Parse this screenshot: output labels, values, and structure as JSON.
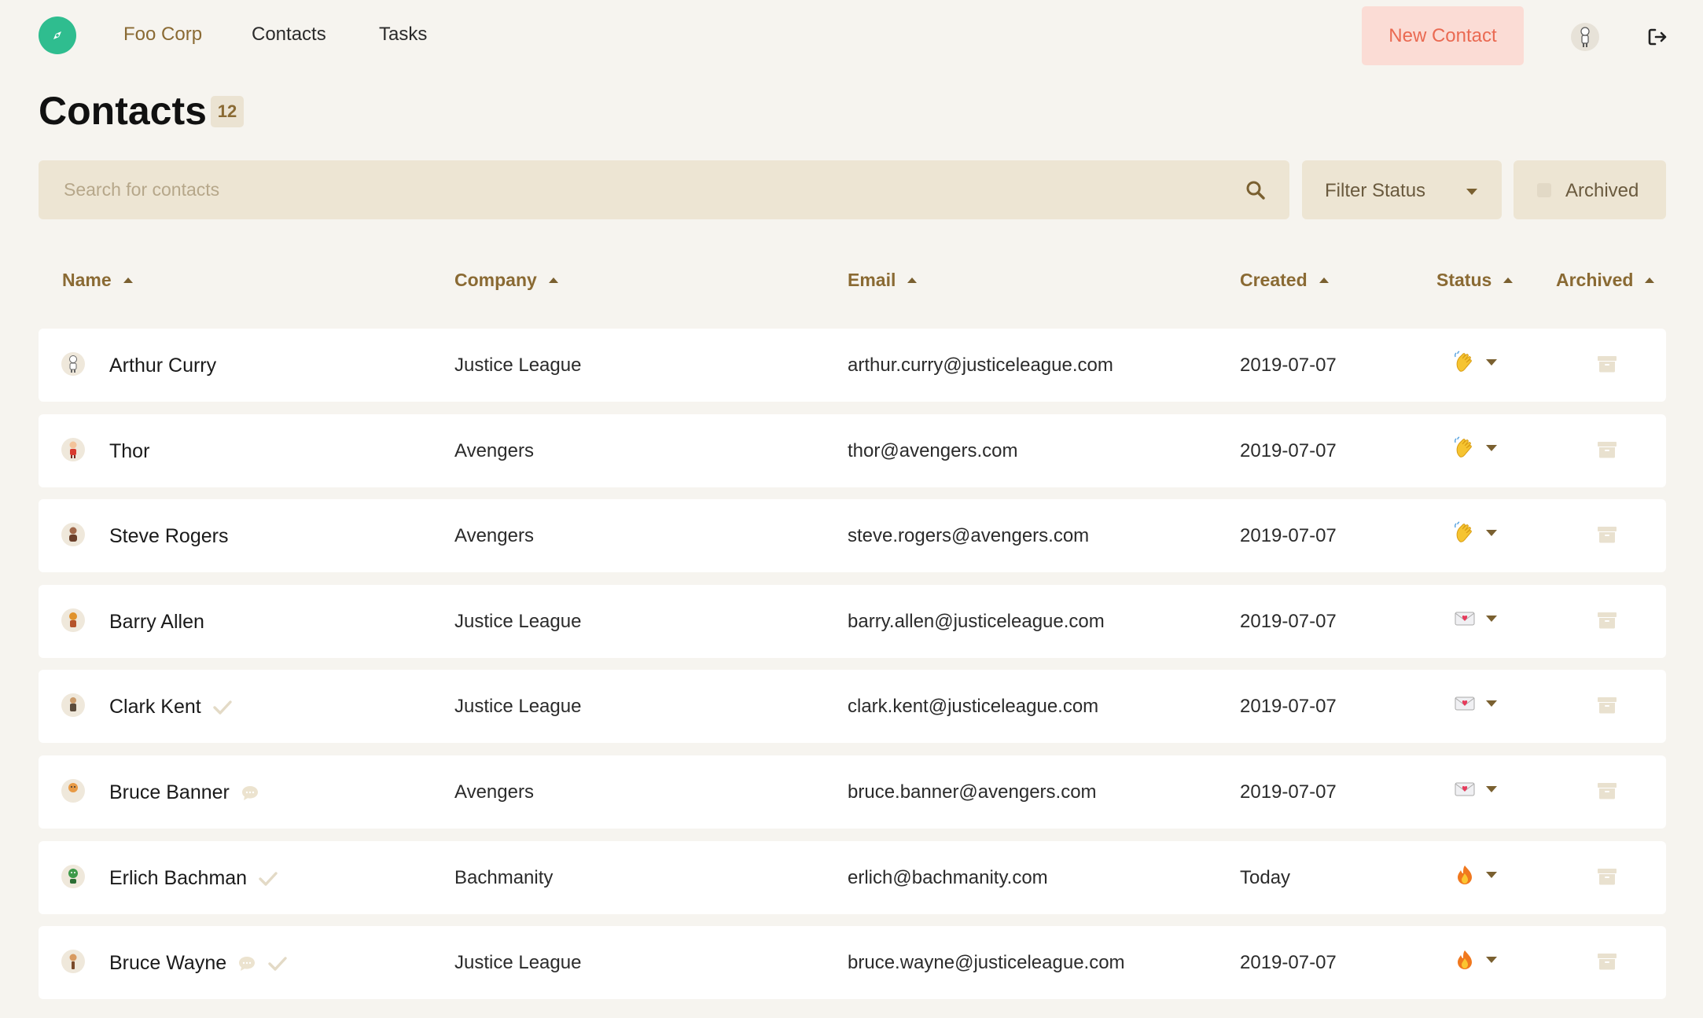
{
  "header": {
    "brand": "Foo Corp",
    "nav": [
      {
        "label": "Contacts"
      },
      {
        "label": "Tasks"
      }
    ],
    "new_contact_label": "New Contact"
  },
  "page": {
    "title": "Contacts",
    "count": "12"
  },
  "toolbar": {
    "search_placeholder": "Search for contacts",
    "search_value": "",
    "filter_label": "Filter Status",
    "archived_label": "Archived"
  },
  "table": {
    "columns": [
      "Name",
      "Company",
      "Email",
      "Created",
      "Status",
      "Archived"
    ],
    "rows": [
      {
        "name": "Arthur Curry",
        "company": "Justice League",
        "email": "arthur.curry@justiceleague.com",
        "created": "2019-07-07",
        "status": "waving-hand",
        "avatar": "arthur",
        "has_comment": false,
        "has_check": false
      },
      {
        "name": "Thor",
        "company": "Avengers",
        "email": "thor@avengers.com",
        "created": "2019-07-07",
        "status": "waving-hand",
        "avatar": "thor",
        "has_comment": false,
        "has_check": false
      },
      {
        "name": "Steve Rogers",
        "company": "Avengers",
        "email": "steve.rogers@avengers.com",
        "created": "2019-07-07",
        "status": "waving-hand",
        "avatar": "steve",
        "has_comment": false,
        "has_check": false
      },
      {
        "name": "Barry Allen",
        "company": "Justice League",
        "email": "barry.allen@justiceleague.com",
        "created": "2019-07-07",
        "status": "love-letter",
        "avatar": "barry",
        "has_comment": false,
        "has_check": false
      },
      {
        "name": "Clark Kent",
        "company": "Justice League",
        "email": "clark.kent@justiceleague.com",
        "created": "2019-07-07",
        "status": "love-letter",
        "avatar": "clark",
        "has_comment": false,
        "has_check": true
      },
      {
        "name": "Bruce Banner",
        "company": "Avengers",
        "email": "bruce.banner@avengers.com",
        "created": "2019-07-07",
        "status": "love-letter",
        "avatar": "banner",
        "has_comment": true,
        "has_check": false
      },
      {
        "name": "Erlich Bachman",
        "company": "Bachmanity",
        "email": "erlich@bachmanity.com",
        "created": "Today",
        "status": "fire",
        "avatar": "erlich",
        "has_comment": false,
        "has_check": true
      },
      {
        "name": "Bruce Wayne",
        "company": "Justice League",
        "email": "bruce.wayne@justiceleague.com",
        "created": "2019-07-07",
        "status": "fire",
        "avatar": "wayne",
        "has_comment": true,
        "has_check": true
      }
    ]
  },
  "colors": {
    "background": "#f6f4ef",
    "accent_brown": "#8a6a33",
    "brand_green": "#2fbd8f",
    "new_contact_bg": "#fbdcd5",
    "new_contact_text": "#ea6a52",
    "toolbar_bg": "#ede5d3"
  },
  "icons": {
    "logo": "compass-icon",
    "search": "search-icon",
    "caret": "caret-down-icon",
    "sort": "sort-up-icon",
    "logout": "logout-icon",
    "archive": "archive-box-icon",
    "comment": "comment-icon",
    "check": "check-icon"
  }
}
